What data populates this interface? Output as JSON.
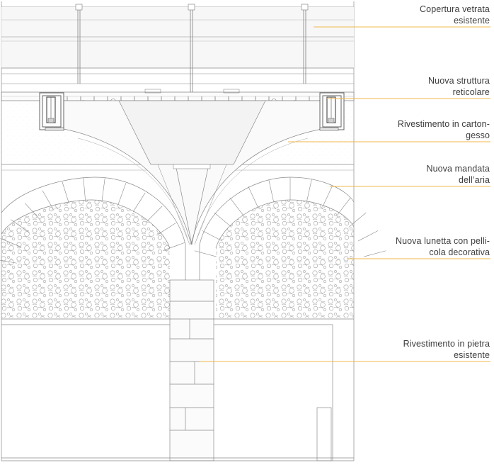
{
  "colors": {
    "leader_line": "#f2b84b",
    "drawing_line": "#8a8a8a",
    "pattern": "#9a9a9a"
  },
  "annotations": [
    {
      "id": "copertura",
      "lines": [
        "Copertura vetrata",
        "esistente"
      ]
    },
    {
      "id": "struttura",
      "lines": [
        "Nuova struttura",
        "reticolare"
      ]
    },
    {
      "id": "cartongesso",
      "lines": [
        "Rivestimento in carton-",
        "gesso"
      ]
    },
    {
      "id": "mandata",
      "lines": [
        "Nuova mandata",
        "dell’aria"
      ]
    },
    {
      "id": "lunetta",
      "lines": [
        "Nuova lunetta con pelli-",
        "cola decorativa"
      ]
    },
    {
      "id": "pietra",
      "lines": [
        "Rivestimento in pietra",
        "esistente"
      ]
    }
  ]
}
